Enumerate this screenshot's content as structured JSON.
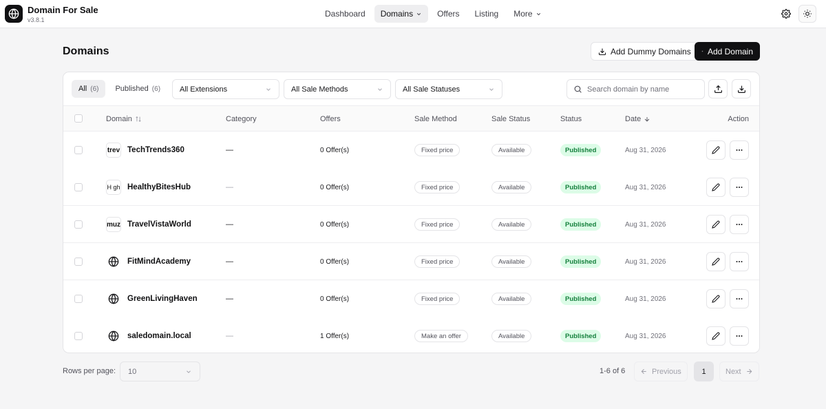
{
  "app": {
    "title": "Domain For Sale",
    "version": "v3.8.1"
  },
  "nav": {
    "items": [
      {
        "label": "Dashboard"
      },
      {
        "label": "Domains"
      },
      {
        "label": "Offers"
      },
      {
        "label": "Listing"
      },
      {
        "label": "More"
      }
    ]
  },
  "header": {
    "settings_icon": "gear-icon",
    "theme_icon": "sun-icon"
  },
  "page": {
    "title": "Domains",
    "add_dummy_label": "Add Dummy Domains",
    "add_domain_label": "Add Domain"
  },
  "filters": {
    "tabs": [
      {
        "label": "All",
        "count": "(6)"
      },
      {
        "label": "Published",
        "count": "(6)"
      }
    ],
    "extensions": "All Extensions",
    "sale_methods": "All Sale Methods",
    "sale_statuses": "All Sale Statuses",
    "search_placeholder": "Search domain by name"
  },
  "table": {
    "headers": {
      "domain": "Domain",
      "category": "Category",
      "offers": "Offers",
      "sale_method": "Sale Method",
      "sale_status": "Sale Status",
      "status": "Status",
      "date": "Date",
      "action": "Action"
    },
    "rows": [
      {
        "logo": "trev",
        "name": "TechTrends360",
        "category": "—",
        "offers": "0 Offer(s)",
        "sale_method": "Fixed price",
        "sale_status": "Available",
        "status": "Published",
        "date": "Aug 31, 2026"
      },
      {
        "logo": "H gh",
        "name": "HealthyBitesHub",
        "category": "—",
        "offers": "0 Offer(s)",
        "sale_method": "Fixed price",
        "sale_status": "Available",
        "status": "Published",
        "date": "Aug 31, 2026"
      },
      {
        "logo": "muz",
        "name": "TravelVistaWorld",
        "category": "—",
        "offers": "0 Offer(s)",
        "sale_method": "Fixed price",
        "sale_status": "Available",
        "status": "Published",
        "date": "Aug 31, 2026"
      },
      {
        "logo": "",
        "name": "FitMindAcademy",
        "category": "—",
        "offers": "0 Offer(s)",
        "sale_method": "Fixed price",
        "sale_status": "Available",
        "status": "Published",
        "date": "Aug 31, 2026"
      },
      {
        "logo": "",
        "name": "GreenLivingHaven",
        "category": "—",
        "offers": "0 Offer(s)",
        "sale_method": "Fixed price",
        "sale_status": "Available",
        "status": "Published",
        "date": "Aug 31, 2026"
      },
      {
        "logo": "",
        "name": "saledomain.local",
        "category": "—",
        "offers": "1 Offer(s)",
        "sale_method": "Make an offer",
        "sale_status": "Available",
        "status": "Published",
        "date": "Aug 31, 2026"
      }
    ]
  },
  "pagination": {
    "rows_per_page_label": "Rows per page:",
    "rows_per_page_value": "10",
    "range": "1-6 of 6",
    "previous": "Previous",
    "page": "1",
    "next": "Next"
  },
  "colors": {
    "primary": "#111113",
    "published_bg": "#dcfce7",
    "published_text": "#15803d",
    "background": "#f5f5f6"
  }
}
